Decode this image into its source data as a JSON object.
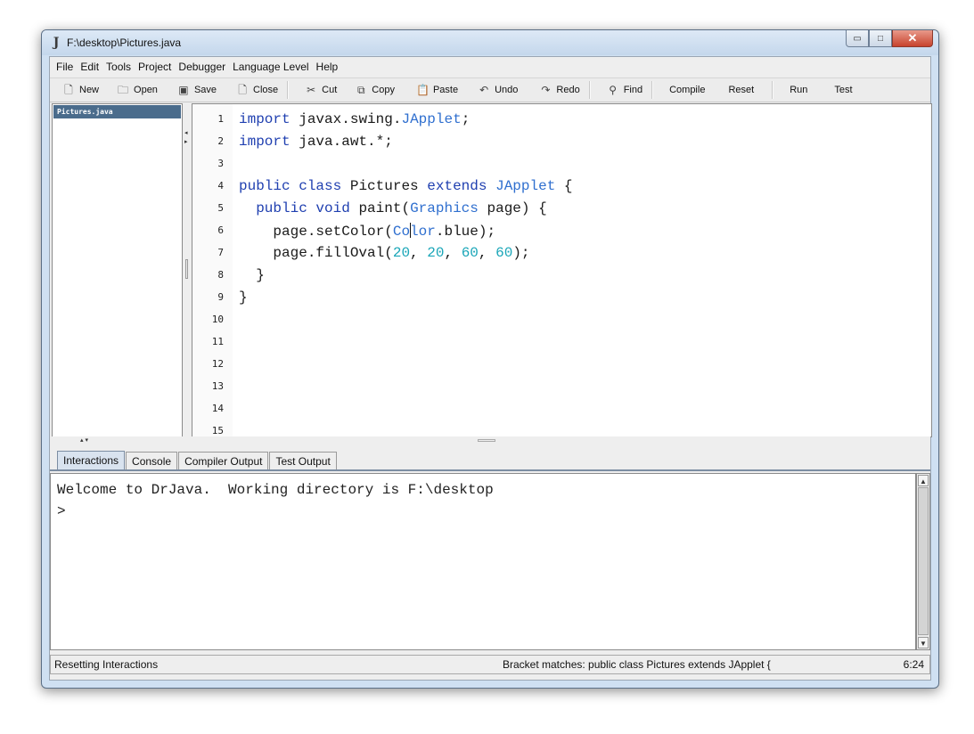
{
  "window": {
    "title": "F:\\desktop\\Pictures.java",
    "app_icon": "drjava-icon",
    "controls": {
      "minimize": "▭",
      "maximize": "□",
      "close": "✕"
    }
  },
  "menu": [
    "File",
    "Edit",
    "Tools",
    "Project",
    "Debugger",
    "Language Level",
    "Help"
  ],
  "toolbar": {
    "new": "New",
    "open": "Open",
    "save": "Save",
    "close": "Close",
    "cut": "Cut",
    "copy": "Copy",
    "paste": "Paste",
    "undo": "Undo",
    "redo": "Redo",
    "find": "Find",
    "compile": "Compile",
    "reset": "Reset",
    "run": "Run",
    "test": "Test"
  },
  "files": {
    "selected": "Pictures.java"
  },
  "editor": {
    "line_numbers": [
      "1",
      "2",
      "3",
      "4",
      "5",
      "6",
      "7",
      "8",
      "9",
      "10",
      "11",
      "12",
      "13",
      "14",
      "15"
    ],
    "lines": [
      "import javax.swing.JApplet;",
      "import java.awt.*;",
      "",
      "public class Pictures extends JApplet {",
      "  public void paint(Graphics page) {",
      "    page.setColor(Color.blue);",
      "    page.fillOval(20, 20, 60, 60);",
      "  }",
      "}"
    ]
  },
  "tabs": [
    "Interactions",
    "Console",
    "Compiler Output",
    "Test Output"
  ],
  "console": {
    "welcome": "Welcome to DrJava.  Working directory is F:\\desktop",
    "prompt": ">"
  },
  "status": {
    "left": "Resetting Interactions",
    "middle": "Bracket matches: public class Pictures extends JApplet {",
    "position": "6:24"
  },
  "colors": {
    "keyword": "#1f3fb0",
    "type": "#2f6fcf",
    "number": "#1aa6b8",
    "selection": "#4a6c8c"
  }
}
